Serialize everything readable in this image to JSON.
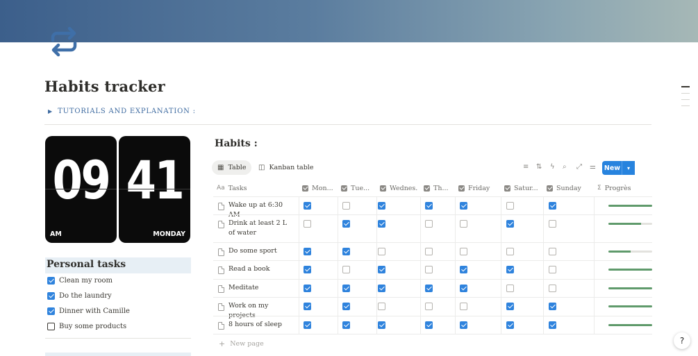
{
  "page": {
    "title": "Habits tracker",
    "toggle_label": "TUTORIALS AND EXPLANATION :",
    "icon": "repeat-arrows-icon",
    "accent": "#3d6aa0"
  },
  "clock": {
    "hours": "09",
    "minutes": "41",
    "period": "AM",
    "day": "MONDAY"
  },
  "personal_tasks": {
    "title": "Personal tasks",
    "items": [
      {
        "label": "Clean my room",
        "checked": true
      },
      {
        "label": "Do the laundry",
        "checked": true
      },
      {
        "label": "Dinner with Camille",
        "checked": true
      },
      {
        "label": "Buy some products",
        "checked": false
      }
    ]
  },
  "habits": {
    "title": "Habits :",
    "views": [
      {
        "label": "Table",
        "icon": "table-icon"
      },
      {
        "label": "Kanban table",
        "icon": "board-icon"
      }
    ],
    "toolbar_icons": [
      "filter-icon",
      "sort-icon",
      "lightning-icon",
      "search-icon",
      "expand-icon",
      "settings-icon"
    ],
    "new_label": "New",
    "columns": [
      "Tasks",
      "Mon...",
      "Tue...",
      "Wednes...",
      "Th...",
      "Friday",
      "Satur...",
      "Sunday",
      "Progrès"
    ],
    "rows": [
      {
        "name": "Wake up at 6:30 AM",
        "days": [
          true,
          false,
          true,
          true,
          true,
          false,
          true
        ],
        "progress": 1.0
      },
      {
        "name": "Drink at least 2 L of water",
        "days": [
          false,
          true,
          true,
          false,
          false,
          true,
          false
        ],
        "progress": 0.75
      },
      {
        "name": "Do some sport",
        "days": [
          true,
          true,
          false,
          false,
          false,
          false,
          false
        ],
        "progress": 0.5
      },
      {
        "name": "Read a book",
        "days": [
          true,
          false,
          true,
          false,
          true,
          true,
          false
        ],
        "progress": 1.0
      },
      {
        "name": "Meditate",
        "days": [
          true,
          true,
          true,
          true,
          true,
          false,
          false
        ],
        "progress": 1.0
      },
      {
        "name": "Work on my projects",
        "days": [
          true,
          true,
          false,
          false,
          false,
          true,
          true
        ],
        "progress": 1.0
      },
      {
        "name": "8 hours of sleep",
        "days": [
          true,
          true,
          true,
          true,
          true,
          true,
          true
        ],
        "progress": 1.0
      }
    ],
    "new_page_label": "New page",
    "colors": {
      "check": "#2f83dd",
      "progress": "#5f9a6b",
      "button": "#2783de"
    }
  },
  "help_label": "?"
}
